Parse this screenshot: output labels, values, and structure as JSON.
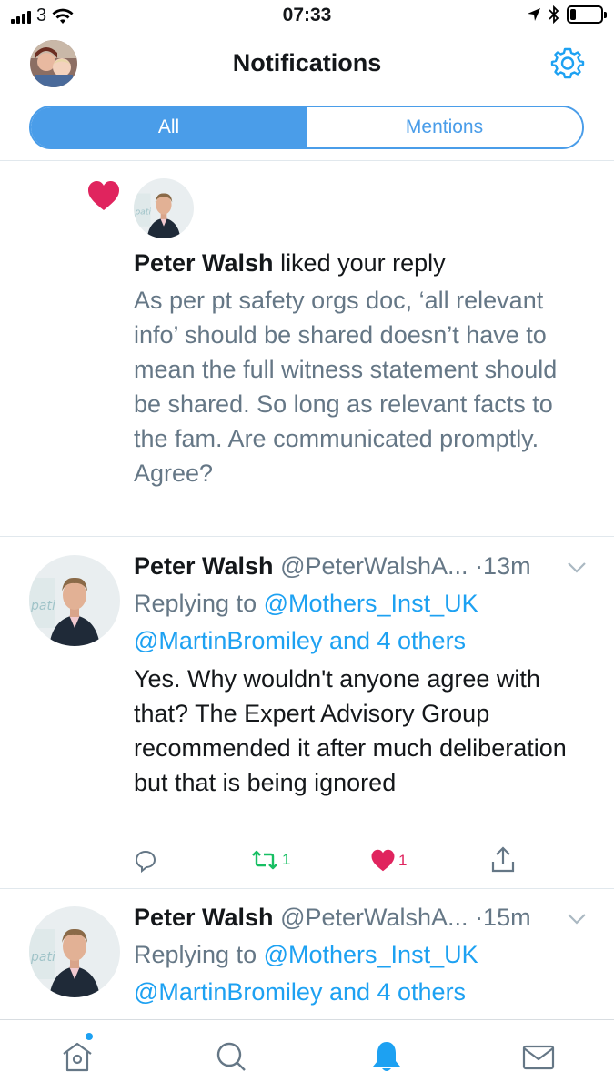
{
  "status_bar": {
    "carrier": "3",
    "time": "07:33",
    "battery_level": 0.2
  },
  "header": {
    "title": "Notifications",
    "settings_icon": "gear-icon"
  },
  "tabs": [
    {
      "label": "All",
      "active": true
    },
    {
      "label": "Mentions",
      "active": false
    }
  ],
  "like_notification": {
    "name": "Peter Walsh",
    "action": " liked your reply",
    "text": "As per pt safety orgs doc, ‘all relevant info’ should be shared doesn’t have to mean the full witness statement should be shared. So long as relevant facts to the fam. Are communicated promptly. Agree?"
  },
  "tweets": [
    {
      "name": "Peter Walsh",
      "handle": "@PeterWalshA...",
      "time": "·13m",
      "replying_prefix": "Replying to ",
      "replying_to": "@Mothers_Inst_UK",
      "replying_rest": "@MartinBromiley and 4 others",
      "body": "Yes. Why wouldn't anyone agree with that? The Expert Advisory Group recommended it after much deliberation but that is being ignored",
      "retweets": "1",
      "likes": "1"
    },
    {
      "name": "Peter Walsh",
      "handle": "@PeterWalshA...",
      "time": "·15m",
      "replying_prefix": "Replying to ",
      "replying_to": "@Mothers_Inst_UK",
      "replying_rest": "@MartinBromiley and 4 others"
    }
  ],
  "colors": {
    "accent": "#1da1f2",
    "segment": "#4a9de9",
    "like": "#e0245e",
    "retweet": "#17bf63",
    "secondary_text": "#657786"
  },
  "tab_bar": [
    "home-icon",
    "search-icon",
    "bell-icon",
    "mail-icon"
  ]
}
